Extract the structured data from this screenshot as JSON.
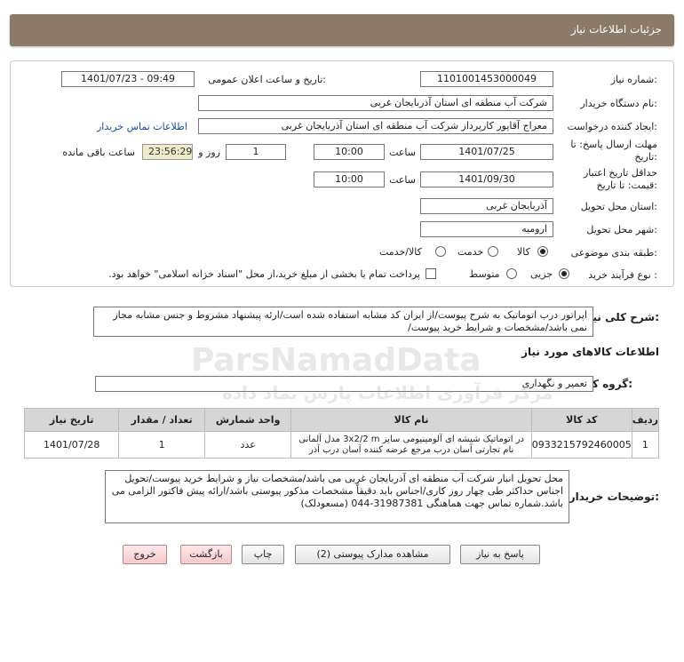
{
  "header": {
    "title": "جزئیات اطلاعات نیاز"
  },
  "form": {
    "need_number_label": "شماره نیاز:",
    "need_number": "1101001453000049",
    "announce_label": "تاریخ و ساعت اعلان عمومی:",
    "announce_value": "1401/07/23 - 09:49",
    "buyer_label": "نام دستگاه خریدار:",
    "buyer_value": "شرکت آب منطقه ای استان آذربایجان غربی",
    "creator_label": "ایجاد کننده درخواست:",
    "creator_value": "معراج آقاپور کارپرداز شرکت آب منطقه ای استان آذربایجان غربی",
    "contact_link": "اطلاعات تماس خریدار",
    "deadline_label": "مهلت ارسال پاسخ: تا تاریخ:",
    "deadline_date": "1401/07/25",
    "time_label": "ساعت",
    "deadline_time": "10:00",
    "days_value": "1",
    "days_label": "روز و",
    "remaining_value": "23:56:29",
    "remaining_label": "ساعت باقی مانده",
    "validity_label": "حداقل تاریخ اعتبار قیمت: تا تاریخ:",
    "validity_date": "1401/09/30",
    "validity_time": "10:00",
    "province_label": "استان محل تحویل:",
    "province_value": "آذربایجان غربی",
    "city_label": "شهر محل تحویل:",
    "city_value": "ارومیه",
    "category_label": "طبقه بندی موضوعی:",
    "category_options": [
      "کالا",
      "خدمت",
      "کالا/خدمت"
    ],
    "category_selected": "کالا",
    "process_label": "نوع فرآیند خرید :",
    "process_options": [
      "جزیی",
      "متوسط"
    ],
    "process_selected": "جزیی",
    "payment_note": "پرداخت تمام یا بخشی از مبلغ خرید،از محل \"اسناد خزانه اسلامی\" خواهد بود."
  },
  "summary": {
    "label": "شرح کلی نیاز:",
    "text": "اپراتور درب اتوماتیک به شرح پیوست/از ایران کد مشابه استفاده شده است/ارئه پیشنهاد مشروط و جنس مشابه مجاز نمی باشد/مشخصات و شرایط خرید پیوست/"
  },
  "goods_info": {
    "title": "اطلاعات کالاهای مورد نیاز",
    "group_label": "گروه کالا:",
    "group_value": "تعمیر و نگهداری"
  },
  "table": {
    "headers": [
      "ردیف",
      "کد کالا",
      "نام کالا",
      "واحد شمارش",
      "تعداد / مقدار",
      "تاریخ نیاز"
    ],
    "rows": [
      {
        "row": "1",
        "code": "0933215792460005",
        "name": "در اتوماتیک شیشه ای آلومینیومی سایز 3x2/2 m مدل آلمانی نام تجارتی آسان درب مرجع عرضه کننده آسان درب آذر",
        "unit": "عدد",
        "qty": "1",
        "date": "1401/07/28"
      }
    ]
  },
  "notes": {
    "label": "توضیحات خریدار:",
    "text": "محل تحویل انبار شرکت آب منطقه ای آذربایجان غربی می باشد/مشخصات نیاز و شرایط خرید پیوست/تحویل اجناس حداکثر طی چهار روز کاری/اجناس باید دقیقاً مشخصات مذکور پیوستی باشد/ارائه پیش فاکتور الزامی می باشد.شماره تماس جهت هماهنگی 31987381-044 (مسعودلک)"
  },
  "buttons": {
    "reply": "پاسخ به نیاز",
    "attachments": "مشاهده مدارک پیوستی (2)",
    "print": "چاپ",
    "back": "بازگشت",
    "exit": "خروج"
  },
  "watermark": {
    "brand": "ParsNamadData",
    "tagline": "مرکز فرآوری اطلاعات پارس نماد داده"
  }
}
